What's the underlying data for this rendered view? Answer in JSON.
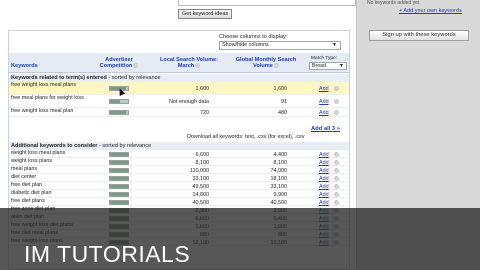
{
  "top": {
    "get_ideas_label": "Get keyword ideas"
  },
  "sidebar": {
    "top_text": "No keywords added yet",
    "add_keywords_link": "+ Add your own keywords",
    "signup_label": "Sign up with these keywords"
  },
  "controls": {
    "choose_columns_label": "Choose columns to display:",
    "choose_columns_value": "Show/hide columns",
    "match_type_label": "Match Type:",
    "match_type_value": "Broad"
  },
  "table": {
    "headers": {
      "keywords": "Keywords",
      "competition": "Advertiser Competition",
      "local": "Local Search Volume: March",
      "global": "Global Monthly Search Volume"
    },
    "section1_title": "Keywords related to term(s) entered",
    "section1_suffix": " - sorted by relevance",
    "section1_rows": [
      {
        "keyword": "free weight loss meal plans",
        "competition": 0.9,
        "local": "1,600",
        "global": "1,600",
        "add": "Add"
      },
      {
        "keyword": "free meal plans for weight loss",
        "competition": 0.55,
        "local": "Not enough data",
        "global": "91",
        "add": "Add"
      },
      {
        "keyword": "free weight loss meal plan",
        "competition": 0.9,
        "local": "720",
        "global": "480",
        "add": "Add"
      }
    ],
    "add_all_label": "Add all 3 »",
    "download_text": "Download all keywords: text, .csv (for excel), .csv",
    "section2_title": "Additional keywords to consider",
    "section2_suffix": " - sorted by relevance",
    "section2_rows": [
      {
        "keyword": "weight loss meal plans",
        "competition": 1.0,
        "local": "6,600",
        "global": "4,400",
        "add": "Add"
      },
      {
        "keyword": "weight loss plans",
        "competition": 1.0,
        "local": "8,100",
        "global": "8,100",
        "add": "Add"
      },
      {
        "keyword": "meal plans",
        "competition": 1.0,
        "local": "110,000",
        "global": "74,000",
        "add": "Add"
      },
      {
        "keyword": "diet center",
        "competition": 1.0,
        "local": "33,100",
        "global": "18,100",
        "add": "Add"
      },
      {
        "keyword": "free diet plan",
        "competition": 1.0,
        "local": "49,500",
        "global": "33,100",
        "add": "Add"
      },
      {
        "keyword": "diabetic diet plan",
        "competition": 1.0,
        "local": "14,800",
        "global": "9,900",
        "add": "Add"
      },
      {
        "keyword": "free diet plans",
        "competition": 1.0,
        "local": "40,500",
        "global": "40,500",
        "add": "Add"
      },
      {
        "keyword": "free zone diet plan",
        "competition": 1.0,
        "local": "2,900",
        "global": "2,900",
        "add": "Add"
      },
      {
        "keyword": "atkin diet plan",
        "competition": 1.0,
        "local": "6,600",
        "global": "5,400",
        "add": "Add"
      },
      {
        "keyword": "free weight loss diet plans",
        "competition": 1.0,
        "local": "1,600",
        "global": "1,900",
        "add": "Add"
      },
      {
        "keyword": "free diet meal plans",
        "competition": 1.0,
        "local": "880",
        "global": "880",
        "add": "Add"
      },
      {
        "keyword": "free weight loss plans",
        "competition": 1.0,
        "local": "12,100",
        "global": "12,100",
        "add": "Add"
      }
    ]
  },
  "overlay": {
    "title": "IM TUTORIALS"
  },
  "colors": {
    "link": "#1a3dc1",
    "header_bg": "#e4ebf5",
    "highlight_row": "#fff7c2",
    "sidebar_bg": "#d9d9d9"
  }
}
